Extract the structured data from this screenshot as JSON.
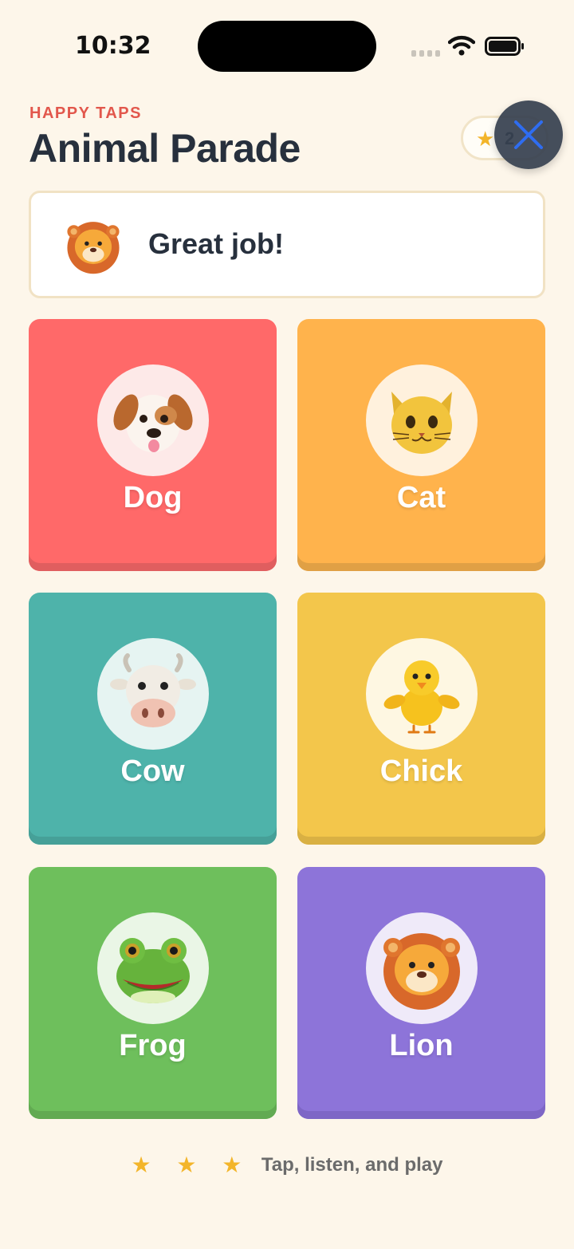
{
  "status_bar": {
    "time": "10:32"
  },
  "header": {
    "eyebrow": "HAPPY TAPS",
    "title": "Animal Parade",
    "score": "2",
    "close_icon": "close-icon"
  },
  "feedback": {
    "message": "Great job!",
    "icon": "lion-face-icon"
  },
  "tiles": [
    {
      "label": "Dog",
      "icon": "dog-face-icon",
      "color": "#ff6969"
    },
    {
      "label": "Cat",
      "icon": "cat-face-icon",
      "color": "#ffb34c"
    },
    {
      "label": "Cow",
      "icon": "cow-face-icon",
      "color": "#4eb3aa"
    },
    {
      "label": "Chick",
      "icon": "chick-icon",
      "color": "#f3c64b"
    },
    {
      "label": "Frog",
      "icon": "frog-face-icon",
      "color": "#6ebf5c"
    },
    {
      "label": "Lion",
      "icon": "lion-face-icon",
      "color": "#8d74d9"
    }
  ],
  "footer": {
    "stars": "★ ★ ★",
    "caption": "Tap, listen, and play"
  }
}
